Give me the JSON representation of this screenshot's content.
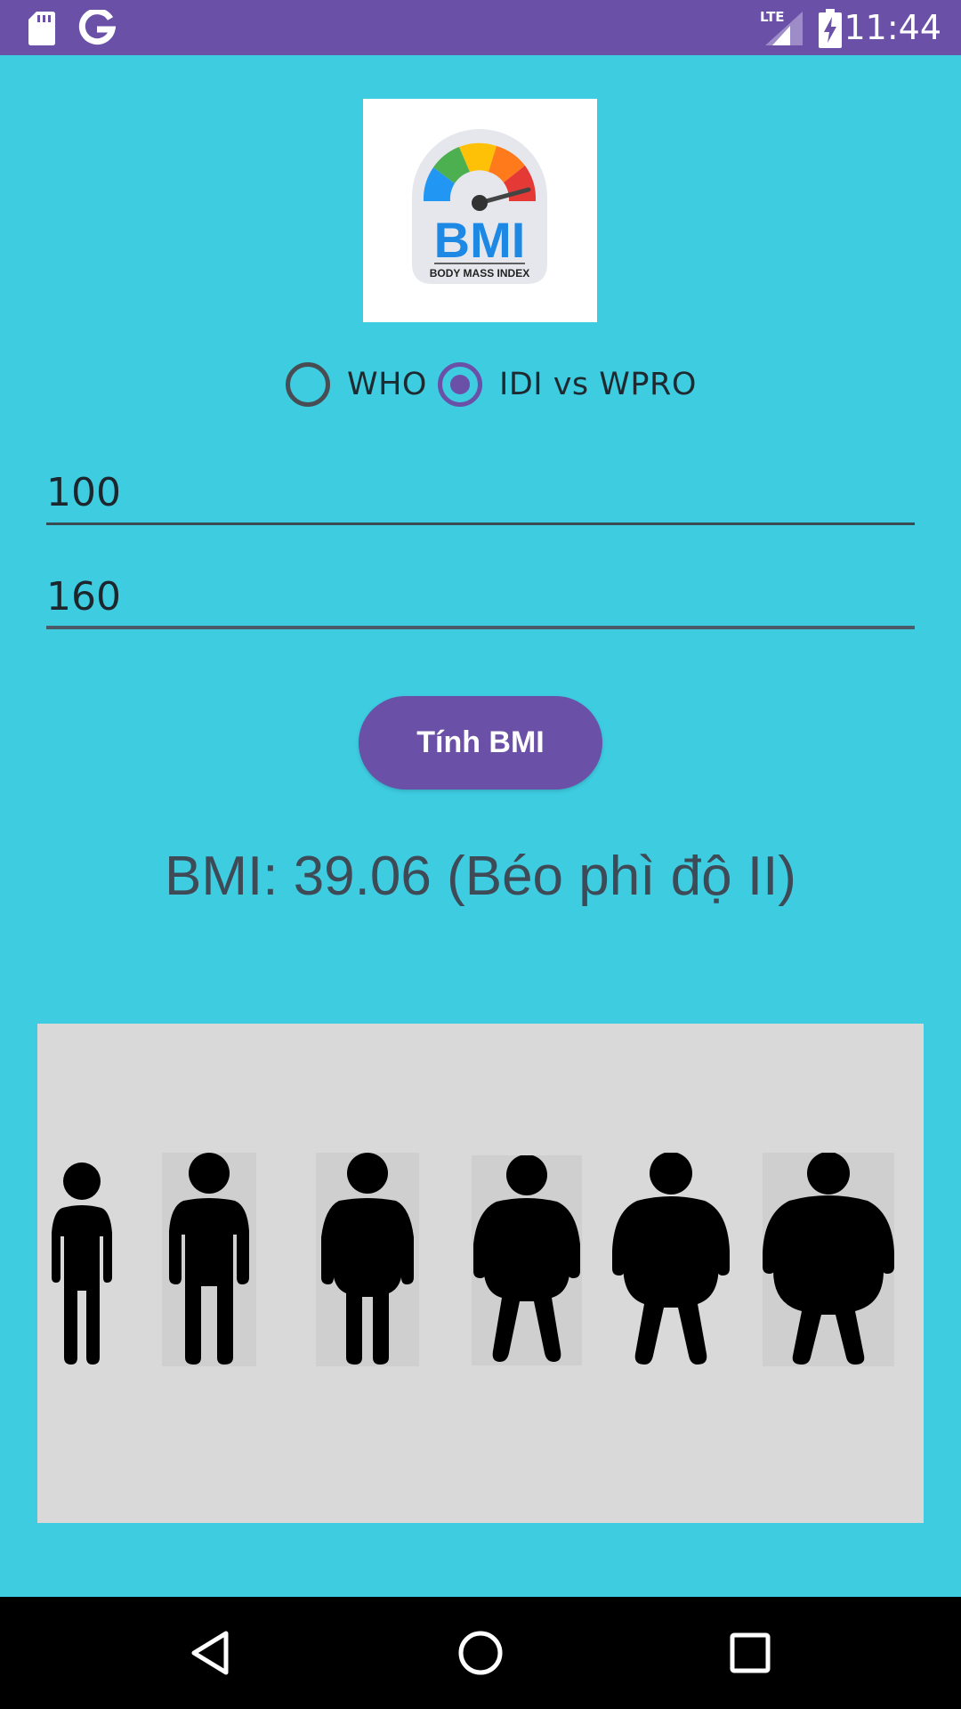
{
  "status_bar": {
    "time": "11:44",
    "network": "LTE",
    "icons": [
      "sd-card-icon",
      "google-icon",
      "signal-icon",
      "battery-charging-icon"
    ]
  },
  "logo": {
    "title": "BMI",
    "subtitle": "BODY MASS INDEX"
  },
  "standard": {
    "options": [
      {
        "label": "WHO",
        "checked": false
      },
      {
        "label": "IDI vs WPRO",
        "checked": true
      }
    ]
  },
  "inputs": {
    "weight": "100",
    "height": "160"
  },
  "button": {
    "label": "Tính BMI"
  },
  "result": {
    "text": "BMI: 39.06 (Béo phì độ II)"
  },
  "figures": {
    "icons": [
      "person-underweight-icon",
      "person-normal-icon",
      "person-overweight-icon",
      "person-obese-1-icon",
      "person-obese-2-icon",
      "person-obese-3-icon"
    ]
  },
  "nav": {
    "icons": [
      "back-icon",
      "home-icon",
      "recents-icon"
    ]
  },
  "colors": {
    "accent": "#6A50A7",
    "background": "#3ECCE1",
    "panel": "#D9D9D9"
  }
}
